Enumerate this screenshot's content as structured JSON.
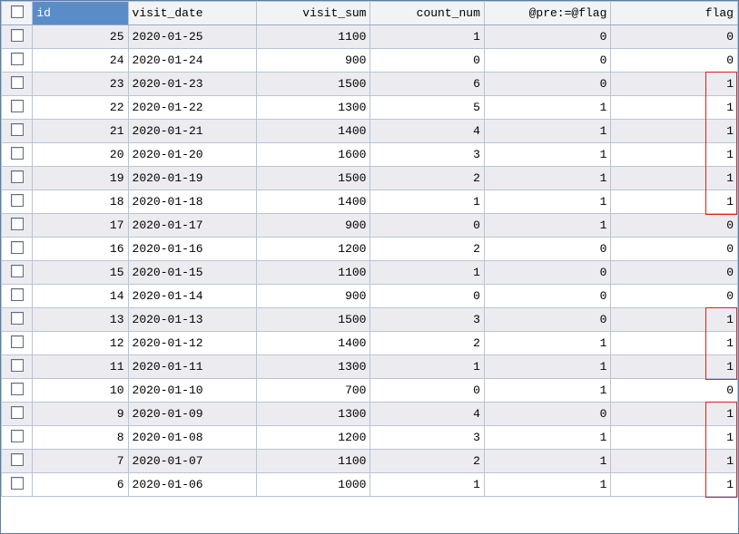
{
  "columns": {
    "id": "id",
    "visit_date": "visit_date",
    "visit_sum": "visit_sum",
    "count_num": "count_num",
    "pre": "@pre:=@flag",
    "flag": "flag"
  },
  "rows": [
    {
      "id": "25",
      "visit_date": "2020-01-25",
      "visit_sum": "1100",
      "count_num": "1",
      "pre": "0",
      "flag": "0"
    },
    {
      "id": "24",
      "visit_date": "2020-01-24",
      "visit_sum": "900",
      "count_num": "0",
      "pre": "0",
      "flag": "0"
    },
    {
      "id": "23",
      "visit_date": "2020-01-23",
      "visit_sum": "1500",
      "count_num": "6",
      "pre": "0",
      "flag": "1"
    },
    {
      "id": "22",
      "visit_date": "2020-01-22",
      "visit_sum": "1300",
      "count_num": "5",
      "pre": "1",
      "flag": "1"
    },
    {
      "id": "21",
      "visit_date": "2020-01-21",
      "visit_sum": "1400",
      "count_num": "4",
      "pre": "1",
      "flag": "1"
    },
    {
      "id": "20",
      "visit_date": "2020-01-20",
      "visit_sum": "1600",
      "count_num": "3",
      "pre": "1",
      "flag": "1"
    },
    {
      "id": "19",
      "visit_date": "2020-01-19",
      "visit_sum": "1500",
      "count_num": "2",
      "pre": "1",
      "flag": "1"
    },
    {
      "id": "18",
      "visit_date": "2020-01-18",
      "visit_sum": "1400",
      "count_num": "1",
      "pre": "1",
      "flag": "1"
    },
    {
      "id": "17",
      "visit_date": "2020-01-17",
      "visit_sum": "900",
      "count_num": "0",
      "pre": "1",
      "flag": "0"
    },
    {
      "id": "16",
      "visit_date": "2020-01-16",
      "visit_sum": "1200",
      "count_num": "2",
      "pre": "0",
      "flag": "0"
    },
    {
      "id": "15",
      "visit_date": "2020-01-15",
      "visit_sum": "1100",
      "count_num": "1",
      "pre": "0",
      "flag": "0"
    },
    {
      "id": "14",
      "visit_date": "2020-01-14",
      "visit_sum": "900",
      "count_num": "0",
      "pre": "0",
      "flag": "0"
    },
    {
      "id": "13",
      "visit_date": "2020-01-13",
      "visit_sum": "1500",
      "count_num": "3",
      "pre": "0",
      "flag": "1"
    },
    {
      "id": "12",
      "visit_date": "2020-01-12",
      "visit_sum": "1400",
      "count_num": "2",
      "pre": "1",
      "flag": "1"
    },
    {
      "id": "11",
      "visit_date": "2020-01-11",
      "visit_sum": "1300",
      "count_num": "1",
      "pre": "1",
      "flag": "1"
    },
    {
      "id": "10",
      "visit_date": "2020-01-10",
      "visit_sum": "700",
      "count_num": "0",
      "pre": "1",
      "flag": "0"
    },
    {
      "id": "9",
      "visit_date": "2020-01-09",
      "visit_sum": "1300",
      "count_num": "4",
      "pre": "0",
      "flag": "1"
    },
    {
      "id": "8",
      "visit_date": "2020-01-08",
      "visit_sum": "1200",
      "count_num": "3",
      "pre": "1",
      "flag": "1"
    },
    {
      "id": "7",
      "visit_date": "2020-01-07",
      "visit_sum": "1100",
      "count_num": "2",
      "pre": "1",
      "flag": "1"
    },
    {
      "id": "6",
      "visit_date": "2020-01-06",
      "visit_sum": "1000",
      "count_num": "1",
      "pre": "1",
      "flag": "1"
    }
  ],
  "highlight_groups": [
    {
      "start": 2,
      "end": 7
    },
    {
      "start": 12,
      "end": 14
    },
    {
      "start": 16,
      "end": 19
    }
  ]
}
